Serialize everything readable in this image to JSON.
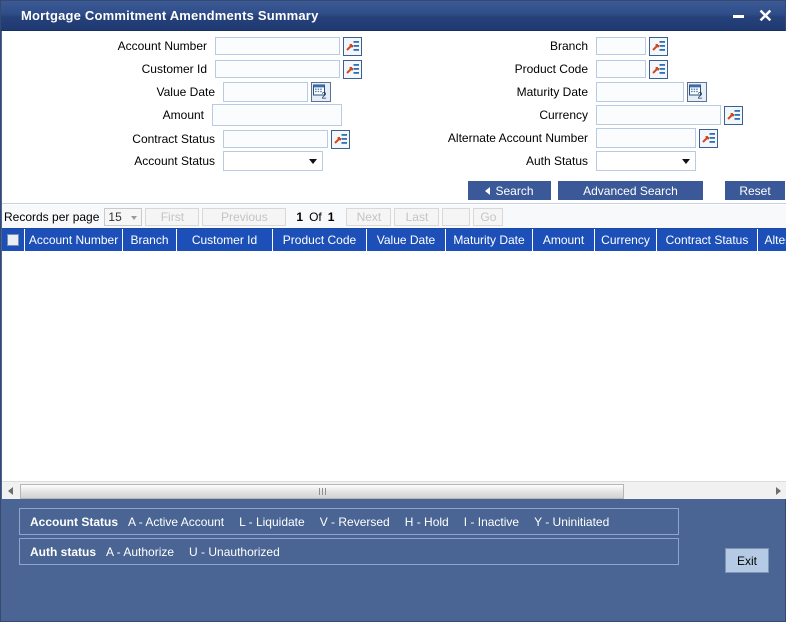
{
  "window": {
    "title": "Mortgage Commitment Amendments Summary",
    "minimize_label": "minimize",
    "close_label": "close"
  },
  "criteria": {
    "left_fields": [
      {
        "label": "Account Number",
        "value": "",
        "control": "text-lookup"
      },
      {
        "label": "Customer Id",
        "value": "",
        "control": "text-lookup"
      },
      {
        "label": "Value Date",
        "value": "",
        "control": "text-calendar"
      },
      {
        "label": "Amount",
        "value": "",
        "control": "text"
      },
      {
        "label": "Contract Status",
        "value": "",
        "control": "text-lookup"
      },
      {
        "label": "Account Status",
        "value": "",
        "control": "select"
      }
    ],
    "right_fields": [
      {
        "label": "Branch",
        "value": "",
        "control": "text-lookup"
      },
      {
        "label": "Product Code",
        "value": "",
        "control": "text-lookup"
      },
      {
        "label": "Maturity Date",
        "value": "",
        "control": "text-calendar"
      },
      {
        "label": "Currency",
        "value": "",
        "control": "text-lookup"
      },
      {
        "label": "Alternate Account Number",
        "value": "",
        "control": "text-lookup"
      },
      {
        "label": "Auth Status",
        "value": "",
        "control": "select"
      }
    ]
  },
  "actions": {
    "search": "Search",
    "advanced_search": "Advanced Search",
    "reset": "Reset"
  },
  "pagination": {
    "records_per_page_label": "Records per page",
    "records_per_page_value": "15",
    "first": "First",
    "previous": "Previous",
    "current_page": "1",
    "of": "Of",
    "total_pages": "1",
    "next": "Next",
    "last": "Last",
    "blank": "",
    "go": "Go"
  },
  "table": {
    "columns": [
      "Account Number",
      "Branch",
      "Customer Id",
      "Product Code",
      "Value Date",
      "Maturity Date",
      "Amount",
      "Currency",
      "Contract Status",
      "Alternate Account N"
    ],
    "rows": []
  },
  "legends": {
    "account_status": {
      "title": "Account Status",
      "items": [
        "A - Active Account",
        "L - Liquidate",
        "V - Reversed",
        "H - Hold",
        "I - Inactive",
        "Y - Uninitiated"
      ]
    },
    "auth_status": {
      "title": "Auth status",
      "items": [
        "A - Authorize",
        "U - Unauthorized"
      ]
    }
  },
  "footer": {
    "exit": "Exit"
  },
  "colors": {
    "titlebar": "#2f4d88",
    "window_bg": "#4a6593",
    "table_header": "#1c50b8",
    "action_button": "#3b5998",
    "lookup_arrow": "#d2491b",
    "lookup_lines": "#2f6fb5"
  }
}
